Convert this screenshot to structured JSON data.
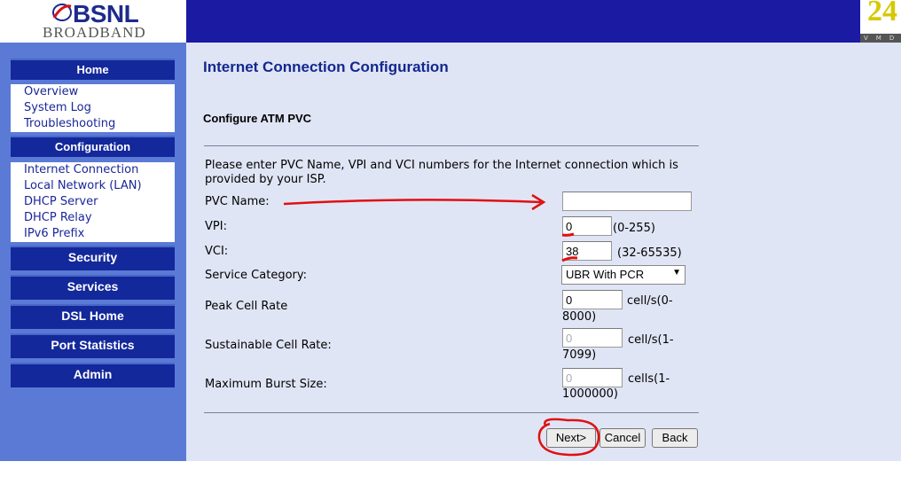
{
  "branding": {
    "logo_top": "BSNL",
    "logo_bottom": "BROADBAND",
    "vendor_mark": "24",
    "vendor_strip": "VMD"
  },
  "sidebar": {
    "home": {
      "label": "Home",
      "items": [
        "Overview",
        "System Log",
        "Troubleshooting"
      ]
    },
    "configuration": {
      "label": "Configuration",
      "items": [
        "Internet Connection",
        "Local Network (LAN)",
        "DHCP Server",
        "DHCP Relay",
        "IPv6 Prefix"
      ]
    },
    "sections": [
      "Security",
      "Services",
      "DSL Home",
      "Port Statistics",
      "Admin"
    ]
  },
  "main": {
    "title": "Internet Connection Configuration",
    "section_title": "Configure ATM PVC",
    "instructions": "Please enter PVC Name, VPI and VCI numbers for the Internet connection which is provided by your ISP.",
    "fields": {
      "pvc_name": {
        "label": "PVC Name:",
        "value": ""
      },
      "vpi": {
        "label": "VPI:",
        "value": "0",
        "hint": "(0-255)"
      },
      "vci": {
        "label": "VCI:",
        "value": "38",
        "hint": "(32-65535)"
      },
      "service_category": {
        "label": "Service Category:",
        "value": "UBR With PCR"
      },
      "peak_cell_rate": {
        "label": "Peak Cell Rate",
        "value": "0",
        "hint_line1": "cell/s(0-",
        "hint_line2": "8000)"
      },
      "sustainable_cell_rate": {
        "label": "Sustainable Cell Rate:",
        "value": "0",
        "hint_line1": "cell/s(1-",
        "hint_line2": "7099)"
      },
      "max_burst_size": {
        "label": "Maximum Burst Size:",
        "value": "0",
        "hint_line1": "cells(1-",
        "hint_line2": "1000000)"
      }
    },
    "buttons": {
      "next": "Next>",
      "cancel": "Cancel",
      "back": "Back"
    }
  },
  "colors": {
    "header_blue": "#1a1aa3",
    "sidebar_blue": "#5b7ad6",
    "menu_header_blue": "#13289a",
    "main_background": "#e0e5f5",
    "annotation_red": "#e01010"
  }
}
